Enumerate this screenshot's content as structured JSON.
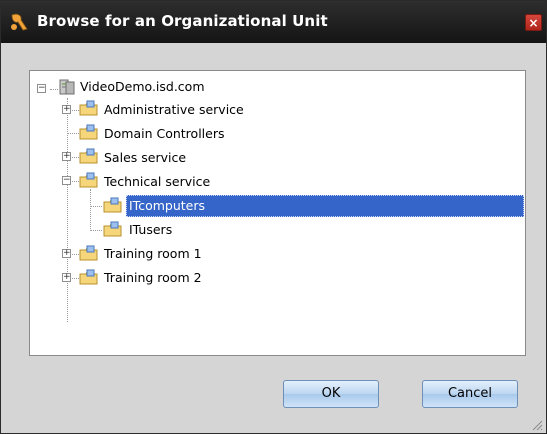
{
  "window": {
    "title": "Browse for an Organizational Unit",
    "close_glyph": "×"
  },
  "tree": {
    "root": {
      "label": "VideoDemo.isd.com",
      "icon": "server-icon",
      "expanded": true
    },
    "items": [
      {
        "label": "Administrative service",
        "expander": "+",
        "level": 1
      },
      {
        "label": "Domain Controllers",
        "expander": "",
        "level": 1
      },
      {
        "label": "Sales service",
        "expander": "+",
        "level": 1
      },
      {
        "label": "Technical service",
        "expander": "−",
        "level": 1
      },
      {
        "label": "ITcomputers",
        "expander": "",
        "level": 2,
        "selected": true
      },
      {
        "label": "ITusers",
        "expander": "",
        "level": 2
      },
      {
        "label": "Training room 1",
        "expander": "+",
        "level": 1
      },
      {
        "label": "Training room 2",
        "expander": "+",
        "level": 1
      }
    ]
  },
  "buttons": {
    "ok": "OK",
    "cancel": "Cancel"
  },
  "colors": {
    "selection": "#3565c8",
    "titlebar": "#1e1e1e",
    "close": "#c0322a"
  }
}
